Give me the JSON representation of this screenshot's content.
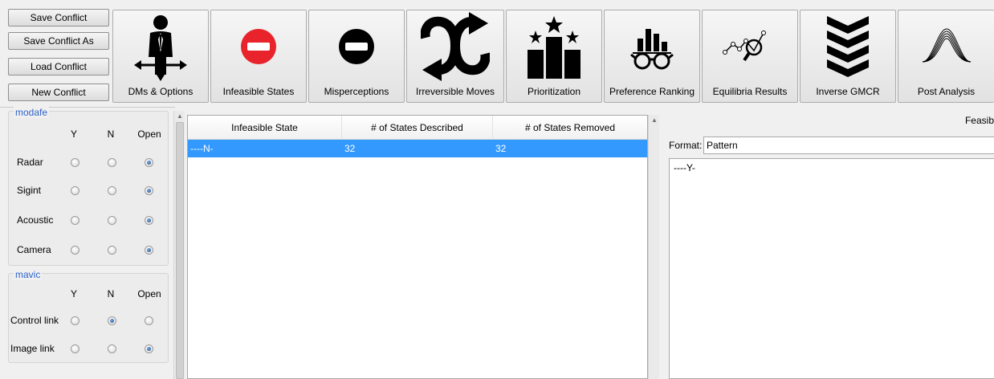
{
  "file_buttons": [
    {
      "label": "Save Conflict"
    },
    {
      "label": "Save Conflict As"
    },
    {
      "label": "Load Conflict"
    },
    {
      "label": "New Conflict"
    }
  ],
  "toolbar": [
    {
      "label": "DMs & Options",
      "icon": "decision-maker-icon"
    },
    {
      "label": "Infeasible States",
      "icon": "no-entry-icon"
    },
    {
      "label": "Misperceptions",
      "icon": "no-entry-dark-icon"
    },
    {
      "label": "Irreversible Moves",
      "icon": "irreversible-arrows-icon"
    },
    {
      "label": "Prioritization",
      "icon": "ranked-podium-icon"
    },
    {
      "label": "Preference Ranking",
      "icon": "bar-chart-glasses-icon"
    },
    {
      "label": "Equilibria Results",
      "icon": "graph-magnifier-icon"
    },
    {
      "label": "Inverse GMCR",
      "icon": "chevrons-down-icon"
    },
    {
      "label": "Post Analysis",
      "icon": "wave-curves-icon"
    }
  ],
  "groups": [
    {
      "name": "modafe",
      "columns": [
        "Y",
        "N",
        "Open"
      ],
      "rows": [
        {
          "label": "Radar",
          "selected": "Open"
        },
        {
          "label": "Sigint",
          "selected": "Open"
        },
        {
          "label": "Acoustic",
          "selected": "Open"
        },
        {
          "label": "Camera",
          "selected": "Open"
        }
      ]
    },
    {
      "name": "mavic",
      "columns": [
        "Y",
        "N",
        "Open"
      ],
      "rows": [
        {
          "label": "Control link",
          "selected": "N"
        },
        {
          "label": "Image link",
          "selected": "Open"
        }
      ]
    }
  ],
  "table": {
    "headers": [
      "Infeasible State",
      "# of States Described",
      "# of States Removed"
    ],
    "rows": [
      {
        "state": "----N-",
        "described": "32",
        "removed": "32",
        "selected": true
      }
    ]
  },
  "right_panel": {
    "title": "Feasib",
    "format_label": "Format:",
    "format_value": "Pattern",
    "pattern_text": "----Y-"
  },
  "colors": {
    "group_title": "#2f63c9",
    "selection": "#3399ff",
    "stop_red": "#e8232b"
  }
}
